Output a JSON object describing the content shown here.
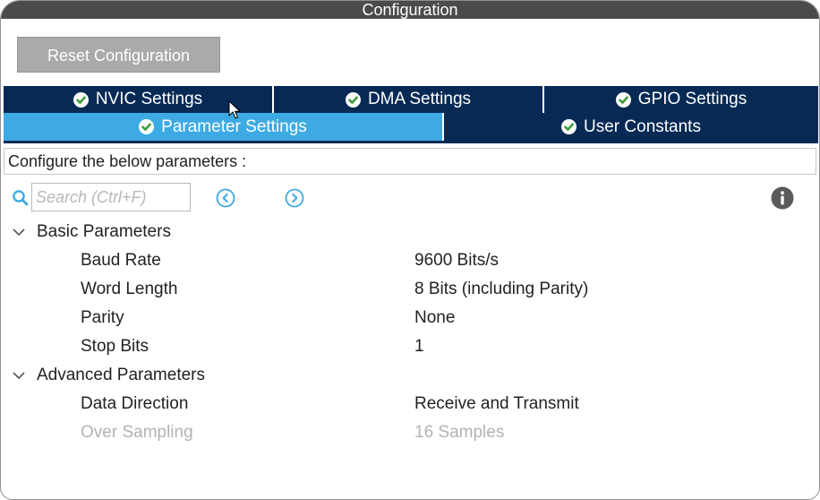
{
  "window": {
    "title": "Configuration"
  },
  "toolbar": {
    "reset_label": "Reset Configuration"
  },
  "tabs": {
    "row1": [
      {
        "label": "NVIC Settings"
      },
      {
        "label": "DMA Settings"
      },
      {
        "label": "GPIO Settings"
      }
    ],
    "row2": [
      {
        "label": "Parameter Settings",
        "active": true
      },
      {
        "label": "User Constants"
      }
    ]
  },
  "description": "Configure the below parameters :",
  "search": {
    "placeholder": "Search (Ctrl+F)",
    "value": ""
  },
  "groups": [
    {
      "label": "Basic Parameters",
      "params": [
        {
          "name": "Baud Rate",
          "value": "9600 Bits/s"
        },
        {
          "name": "Word Length",
          "value": "8 Bits (including Parity)"
        },
        {
          "name": "Parity",
          "value": "None"
        },
        {
          "name": "Stop Bits",
          "value": "1"
        }
      ]
    },
    {
      "label": "Advanced Parameters",
      "params": [
        {
          "name": "Data Direction",
          "value": "Receive and Transmit"
        },
        {
          "name": "Over Sampling",
          "value": "16 Samples",
          "disabled": true
        }
      ]
    }
  ],
  "colors": {
    "tab_dark": "#072a55",
    "tab_active": "#3daae4",
    "check_green": "#3e9e3a",
    "icon_blue": "#3daae4",
    "title_bar": "#4b4b4b",
    "reset_button": "#a8aaac",
    "disabled_text": "#b3b3b3"
  },
  "icons": {
    "tab_status": "check-circle-icon",
    "search": "search-icon",
    "previous": "previous-icon",
    "next": "next-icon",
    "info": "info-icon",
    "expand": "chevron-down-icon"
  }
}
